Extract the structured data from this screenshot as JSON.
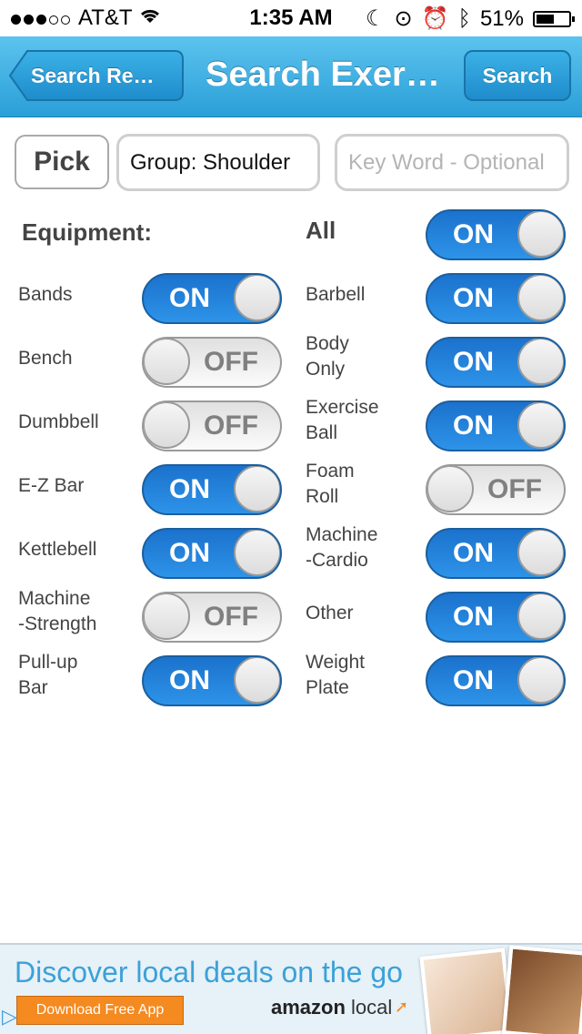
{
  "status_bar": {
    "carrier": "AT&T",
    "time": "1:35 AM",
    "battery": "51%"
  },
  "nav": {
    "back_label": "Search Re…",
    "title": "Search Exer…",
    "search_label": "Search"
  },
  "filters": {
    "pick_label": "Pick",
    "group_value": "Group: Shoulder",
    "keyword_placeholder": "Key Word - Optional"
  },
  "equipment": {
    "heading": "Equipment:",
    "all_label": "All",
    "all_state": "ON",
    "left": [
      {
        "label": "Bands",
        "state": "ON"
      },
      {
        "label": "Bench",
        "state": "OFF"
      },
      {
        "label": "Dumbbell",
        "state": "OFF"
      },
      {
        "label": "E-Z Bar",
        "state": "ON"
      },
      {
        "label": "Kettlebell",
        "state": "ON"
      },
      {
        "label": "Machine\n-Strength",
        "state": "OFF"
      },
      {
        "label": "Pull-up\nBar",
        "state": "ON"
      }
    ],
    "right": [
      {
        "label": "Barbell",
        "state": "ON"
      },
      {
        "label": "Body\nOnly",
        "state": "ON"
      },
      {
        "label": "Exercise\nBall",
        "state": "ON"
      },
      {
        "label": "Foam\nRoll",
        "state": "OFF"
      },
      {
        "label": "Machine\n-Cardio",
        "state": "ON"
      },
      {
        "label": "Other",
        "state": "ON"
      },
      {
        "label": "Weight\nPlate",
        "state": "ON"
      }
    ]
  },
  "ad": {
    "headline": "Discover local deals on the go",
    "button": "Download Free App",
    "brand": "amazon",
    "brand_suffix": "local"
  },
  "colors": {
    "nav_bar": "#2a9fd8",
    "toggle_on": "#1b72cc",
    "toggle_off": "#f0f0f0",
    "ad_button": "#f48a20"
  }
}
